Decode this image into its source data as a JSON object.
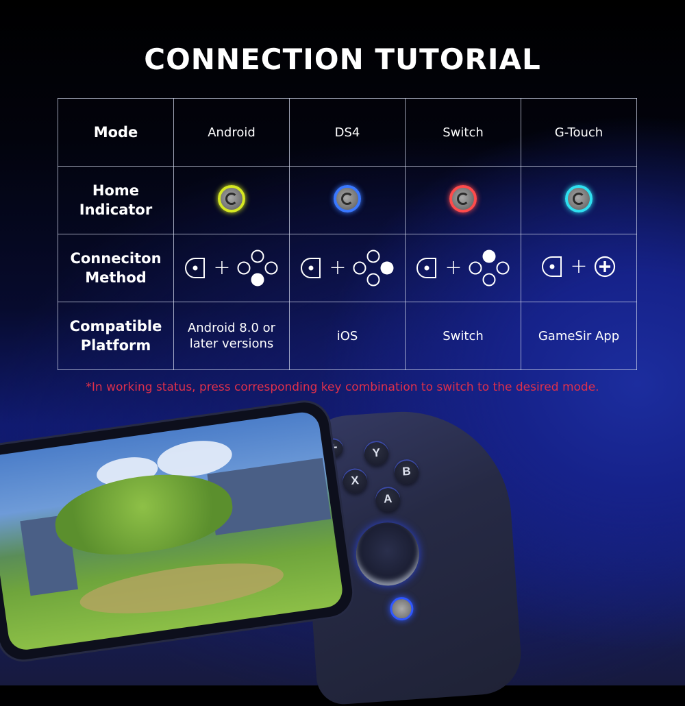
{
  "title": "CONNECTION TUTORIAL",
  "table": {
    "row_headers": {
      "mode": "Mode",
      "home_indicator_line1": "Home",
      "home_indicator_line2": "Indicator",
      "connection_method_line1": "Conneciton",
      "connection_method_line2": "Method",
      "compatible_platform_line1": "Compatible",
      "compatible_platform_line2": "Platform"
    },
    "modes": [
      {
        "name": "Android",
        "indicator_color": "#d6e822",
        "combo": {
          "button": "home-button",
          "plus": "+",
          "target": "face-buttons-bottom"
        },
        "platform_line1": "Android  8.0 or",
        "platform_line2": "later versions"
      },
      {
        "name": "DS4",
        "indicator_color": "#3a78ff",
        "combo": {
          "button": "home-button",
          "plus": "+",
          "target": "face-buttons-right"
        },
        "platform_line1": "iOS",
        "platform_line2": ""
      },
      {
        "name": "Switch",
        "indicator_color": "#ff4b4b",
        "combo": {
          "button": "home-button",
          "plus": "+",
          "target": "face-buttons-top"
        },
        "platform_line1": "Switch",
        "platform_line2": ""
      },
      {
        "name": "G-Touch",
        "indicator_color": "#2fe0f0",
        "combo": {
          "button": "home-button",
          "plus": "+",
          "target": "plus-button"
        },
        "platform_line1": "GameSir App",
        "platform_line2": ""
      }
    ]
  },
  "note": "*In working status, press corresponding key combination to switch to the desired mode.",
  "controller": {
    "buttons": [
      "Y",
      "X",
      "B",
      "A"
    ],
    "plus_label": "+"
  },
  "colors": {
    "note": "#e0304a",
    "border": "#d2d7eb",
    "accent_blue": "#2f57ff"
  }
}
